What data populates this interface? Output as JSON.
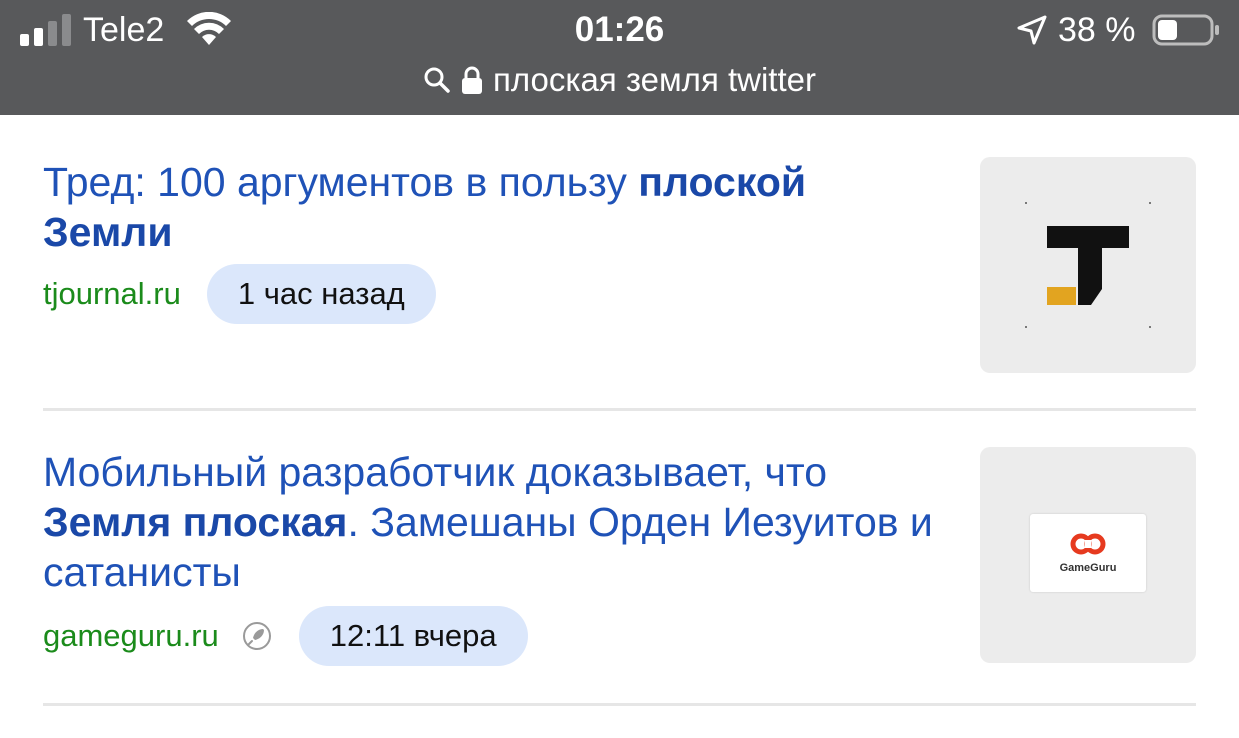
{
  "status_bar": {
    "carrier": "Tele2",
    "time": "01:26",
    "battery": "38 %",
    "battery_level": 0.38,
    "signal_bars": 2,
    "icons": [
      "signal-icon",
      "wifi-icon",
      "location-arrow-icon",
      "battery-icon",
      "search-icon",
      "lock-icon"
    ]
  },
  "address_bar": {
    "query": "плоская земля twitter"
  },
  "results": [
    {
      "title_parts": [
        "Тред: 100 аргументов в пользу ",
        "плоской Земли"
      ],
      "source": "tjournal.ru",
      "time": "1 час назад",
      "thumb_logo": "tjournal-logo"
    },
    {
      "title_parts": [
        "Мобильный разработчик доказывает, что ",
        "Земля плоская",
        ". Замешаны Орден Иезуитов и сатанисты"
      ],
      "source": "gameguru.ru",
      "time": "12:11 вчера",
      "thumb_logo": "gameguru-logo",
      "logo_text": "GameGuru"
    }
  ],
  "colors": {
    "status_bg": "#58595b",
    "link_blue": "#1f52b7",
    "source_green": "#1b8b1b",
    "chip_bg": "#dbe7fb",
    "thumb_bg": "#ececec"
  }
}
